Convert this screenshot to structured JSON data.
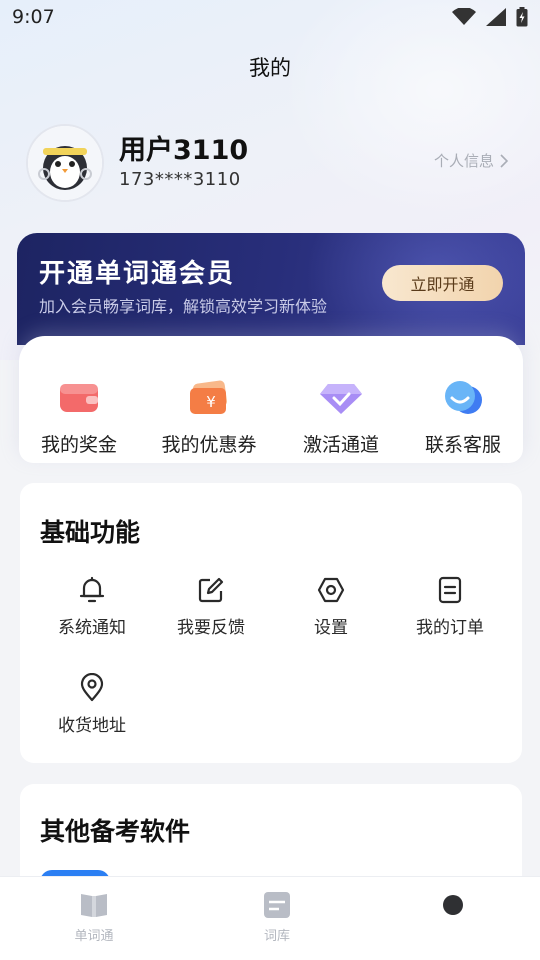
{
  "status_bar": {
    "time": "9:07"
  },
  "page": {
    "title": "我的"
  },
  "profile": {
    "name": "用户3110",
    "phone": "173****3110",
    "info_link": "个人信息"
  },
  "vip": {
    "title": "开通单词通会员",
    "subtitle": "加入会员畅享词库，解锁高效学习新体验",
    "button": "立即开通"
  },
  "quick_actions": [
    {
      "label": "我的奖金",
      "icon": "wallet-icon"
    },
    {
      "label": "我的优惠券",
      "icon": "coupon-icon"
    },
    {
      "label": "激活通道",
      "icon": "diamond-icon"
    },
    {
      "label": "联系客服",
      "icon": "chat-bubble-icon"
    }
  ],
  "basic": {
    "title": "基础功能",
    "items": [
      {
        "label": "系统通知",
        "icon": "bell-icon"
      },
      {
        "label": "我要反馈",
        "icon": "edit-icon"
      },
      {
        "label": "设置",
        "icon": "gear-icon"
      },
      {
        "label": "我的订单",
        "icon": "document-icon"
      },
      {
        "label": "收货地址",
        "icon": "location-pin-icon"
      }
    ]
  },
  "other": {
    "title": "其他备考软件"
  },
  "bottom_nav": [
    {
      "label": "单词通",
      "icon": "book-icon"
    },
    {
      "label": "词库",
      "icon": "word-bank-icon"
    },
    {
      "label": "",
      "icon": "profile-icon"
    }
  ],
  "colors": {
    "vip_bg": "#1d2462",
    "vip_button": "#f2d4ad",
    "accent_blue": "#2b7ff3",
    "page_bg": "#f3f4f7"
  }
}
